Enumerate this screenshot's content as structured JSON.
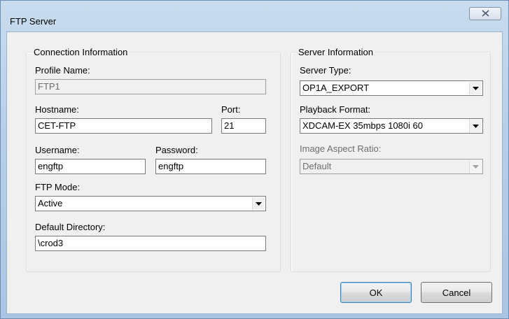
{
  "window": {
    "title": "FTP Server",
    "close_icon": "close-x-icon"
  },
  "connection": {
    "legend": "Connection Information",
    "profile_name_label": "Profile Name:",
    "profile_name_value": "FTP1",
    "hostname_label": "Hostname:",
    "hostname_value": "CET-FTP",
    "port_label": "Port:",
    "port_value": "21",
    "username_label": "Username:",
    "username_value": "engftp",
    "password_label": "Password:",
    "password_value": "engftp",
    "ftp_mode_label": "FTP Mode:",
    "ftp_mode_value": "Active",
    "default_directory_label": "Default Directory:",
    "default_directory_value": "\\crod3"
  },
  "server": {
    "legend": "Server Information",
    "server_type_label": "Server Type:",
    "server_type_value": "OP1A_EXPORT",
    "playback_format_label": "Playback Format:",
    "playback_format_value": "XDCAM-EX 35mbps 1080i 60",
    "aspect_ratio_label": "Image Aspect Ratio:",
    "aspect_ratio_value": "Default"
  },
  "buttons": {
    "ok": "OK",
    "cancel": "Cancel"
  }
}
